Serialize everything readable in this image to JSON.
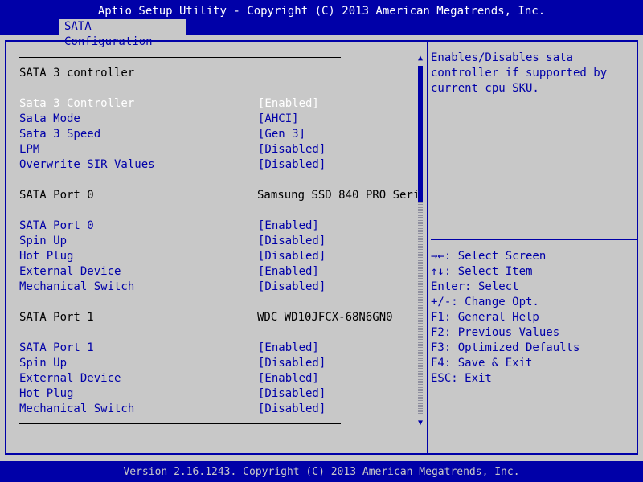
{
  "header": {
    "title": "Aptio Setup Utility - Copyright (C) 2013 American Megatrends, Inc.",
    "tab": "SATA Configuration"
  },
  "section_title": "SATA 3 controller",
  "settings": [
    {
      "label": "Sata 3 Controller",
      "value": "[Enabled]"
    },
    {
      "label": "Sata Mode",
      "value": "[AHCI]"
    },
    {
      "label": "Sata 3 Speed",
      "value": "[Gen 3]"
    },
    {
      "label": "LPM",
      "value": "[Disabled]"
    },
    {
      "label": "Overwrite SIR Values",
      "value": "[Disabled]"
    }
  ],
  "port0": {
    "label": "SATA Port 0",
    "device": "Samsung SSD 840 PRO Seri",
    "settings": [
      {
        "label": "SATA Port 0",
        "value": "[Enabled]"
      },
      {
        "label": "Spin Up",
        "value": "[Disabled]"
      },
      {
        "label": "Hot Plug",
        "value": "[Disabled]"
      },
      {
        "label": "External Device",
        "value": "[Enabled]"
      },
      {
        "label": "Mechanical Switch",
        "value": "[Disabled]"
      }
    ]
  },
  "port1": {
    "label": "SATA Port 1",
    "device": "WDC WD10JFCX-68N6GN0",
    "settings": [
      {
        "label": "SATA Port 1",
        "value": "[Enabled]"
      },
      {
        "label": "Spin Up",
        "value": "[Disabled]"
      },
      {
        "label": "External Device",
        "value": "[Enabled]"
      },
      {
        "label": "Hot Plug",
        "value": "[Disabled]"
      },
      {
        "label": "Mechanical Switch",
        "value": "[Disabled]"
      }
    ]
  },
  "help": {
    "lines": [
      "Enables/Disables sata",
      "controller if supported by",
      "current cpu SKU."
    ]
  },
  "keys": [
    "→←: Select Screen",
    "↑↓: Select Item",
    "Enter: Select",
    "+/-: Change Opt.",
    "F1: General Help",
    "F2: Previous Values",
    "F3: Optimized Defaults",
    "F4: Save & Exit",
    "ESC: Exit"
  ],
  "footer": "Version 2.16.1243. Copyright (C) 2013 American Megatrends, Inc.",
  "colors": {
    "bios_blue": "#0000a8",
    "bios_gray": "#c8c8c8",
    "selected_text": "#ffffff"
  },
  "icons": {
    "scroll_up": "up-triangle",
    "scroll_down": "down-triangle"
  }
}
